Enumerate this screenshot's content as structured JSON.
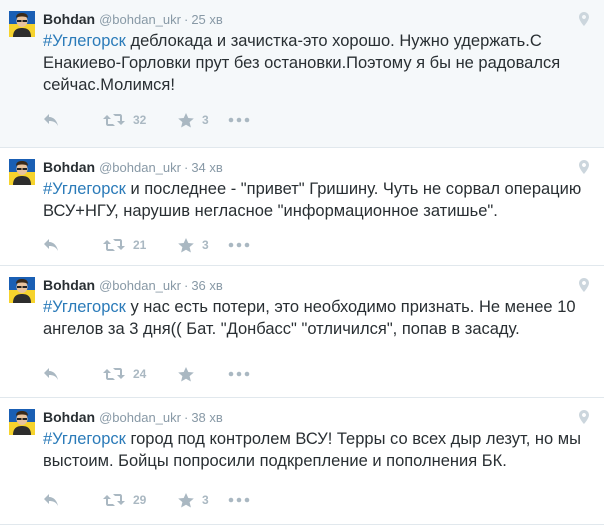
{
  "tweets": [
    {
      "name": "Bohdan",
      "handle": "@bohdan_ukr",
      "separator": "·",
      "time": "25 хв",
      "hashtag": "#Углегорск",
      "body": " деблокада и зачистка-это хорошо. Нужно удержать.С Енакиево-Горловки прут без остановки.Поэтому я бы не радовался сейчас.Молимся!",
      "retweets": "32",
      "favorites": "3"
    },
    {
      "name": "Bohdan",
      "handle": "@bohdan_ukr",
      "separator": "·",
      "time": "34 хв",
      "hashtag": "#Углегорск",
      "body": " и последнее - \"привет\" Гришину. Чуть не сорвал операцию ВСУ+НГУ, нарушив негласное \"информационное затишье\".",
      "retweets": "21",
      "favorites": "3"
    },
    {
      "name": "Bohdan",
      "handle": "@bohdan_ukr",
      "separator": "·",
      "time": "36 хв",
      "hashtag": "#Углегорск",
      "body": " у нас есть потери, это необходимо признать. Не менее 10 ангелов за 3 дня(( Бат. \"Донбасс\" \"отличился\", попав в засаду.",
      "retweets": "24",
      "favorites": ""
    },
    {
      "name": "Bohdan",
      "handle": "@bohdan_ukr",
      "separator": "·",
      "time": "38 хв",
      "hashtag": "#Углегорск",
      "body": " город под контролем ВСУ! Терры со всех дыр лезут, но мы выстоим. Бойцы попросили подкрепление и пополнения БК.",
      "retweets": "29",
      "favorites": "3"
    }
  ],
  "icons": {
    "reply": "reply-icon",
    "retweet": "retweet-icon",
    "favorite": "star-icon",
    "more": "more-icon",
    "geo": "location-pin-icon"
  },
  "colors": {
    "hashtag": "#2b7bb9",
    "muted": "#8899a6",
    "action": "#aab8c2",
    "avatar_blue": "#1a5fb4",
    "avatar_yellow": "#f6d32d"
  }
}
